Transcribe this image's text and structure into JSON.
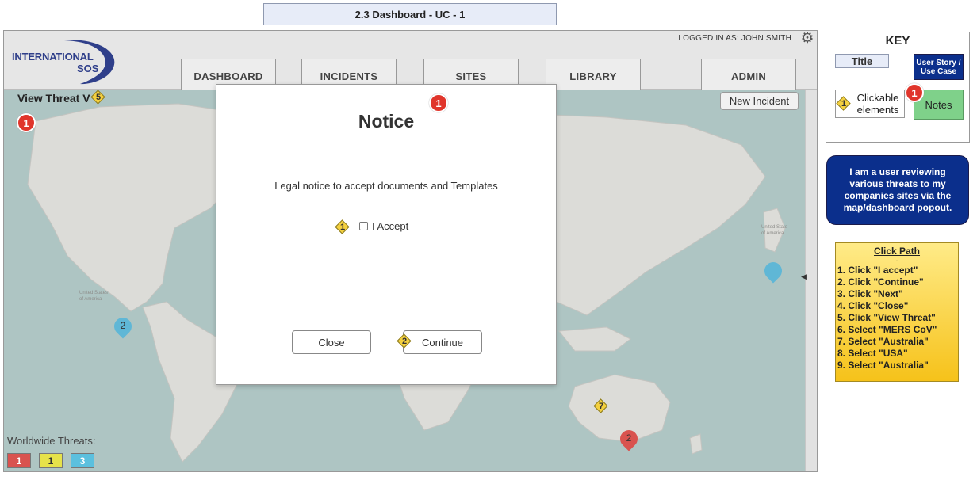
{
  "page_title": "2.3 Dashboard - UC - 1",
  "header": {
    "logo_line1": "INTERNATIONAL",
    "logo_line2": "SOS",
    "logged_in": "LOGGED IN AS: JOHN SMITH",
    "tabs": [
      "DASHBOARD",
      "INCIDENTS",
      "SITES",
      "LIBRARY",
      "ADMIN"
    ]
  },
  "map": {
    "view_threat_label": "View Threat V",
    "new_incident_label": "New Incident",
    "worldwide_label": "Worldwide Threats:",
    "threat_counts": [
      {
        "value": "1",
        "color": "#d9534f"
      },
      {
        "value": "1",
        "color": "#e6e24a"
      },
      {
        "value": "3",
        "color": "#5bc0de"
      }
    ],
    "pins": [
      {
        "region": "United States",
        "count": "2",
        "color": "#5fb7d6"
      },
      {
        "region": "Australia",
        "count": "2",
        "color": "#d9534f"
      },
      {
        "region": "Japan",
        "count": "",
        "color": "#5fb7d6"
      }
    ]
  },
  "annotations": {
    "notes_marker": "1",
    "view_threat_step": "5",
    "accept_step": "1",
    "continue_step": "2",
    "australia_step": "7"
  },
  "modal": {
    "title": "Notice",
    "body": "Legal notice to accept documents and Templates",
    "accept_label": "I Accept",
    "close_label": "Close",
    "continue_label": "Continue"
  },
  "key": {
    "heading": "KEY",
    "title_label": "Title",
    "story_label": "User Story / Use Case",
    "clickable_label": "Clickable elements",
    "clickable_num": "1",
    "notes_label": "Notes",
    "notes_num": "1"
  },
  "user_story": "I am a user reviewing various threats to my companies sites via the map/dashboard popout.",
  "click_path": {
    "title": "Click Path",
    "separator": "-",
    "steps": [
      "1. Click \"I accept\"",
      "2. Click \"Continue\"",
      "3. Click \"Next\"",
      "4. Click \"Close\"",
      "5. Click \"View Threat\"",
      "6. Select \"MERS CoV\"",
      "7. Select \"Australia\"",
      "8. Select \"USA\"",
      "9. Select \"Australia\""
    ]
  }
}
